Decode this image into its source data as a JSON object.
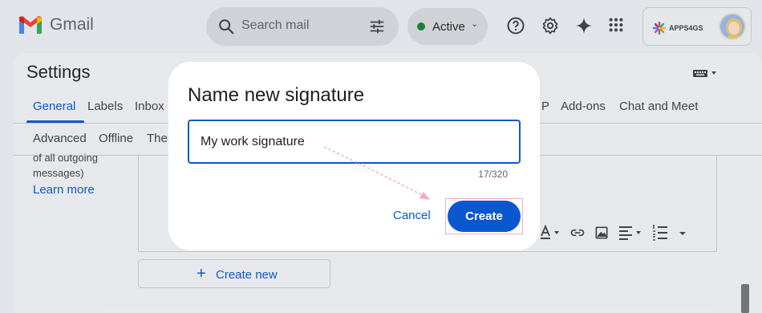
{
  "header": {
    "app_name": "Gmail",
    "search_placeholder": "Search mail",
    "status_label": "Active",
    "account_brand": "APPS4GS"
  },
  "settings": {
    "title": "Settings",
    "tabs_row1": [
      "General",
      "Labels",
      "Inbox",
      "P",
      "Add-ons",
      "Chat and Meet"
    ],
    "tabs_row2": [
      "Advanced",
      "Offline",
      "Ther"
    ],
    "side_text_line1": "of all outgoing",
    "side_text_line2": "messages)",
    "learn_more": "Learn more",
    "create_new_label": "Create new"
  },
  "dialog": {
    "title": "Name new signature",
    "input_value": "My work signature",
    "counter": "17/320",
    "cancel_label": "Cancel",
    "create_label": "Create"
  },
  "colors": {
    "accent": "#0b57d0",
    "highlight": "#f2a8c9",
    "status_green": "#178038"
  }
}
